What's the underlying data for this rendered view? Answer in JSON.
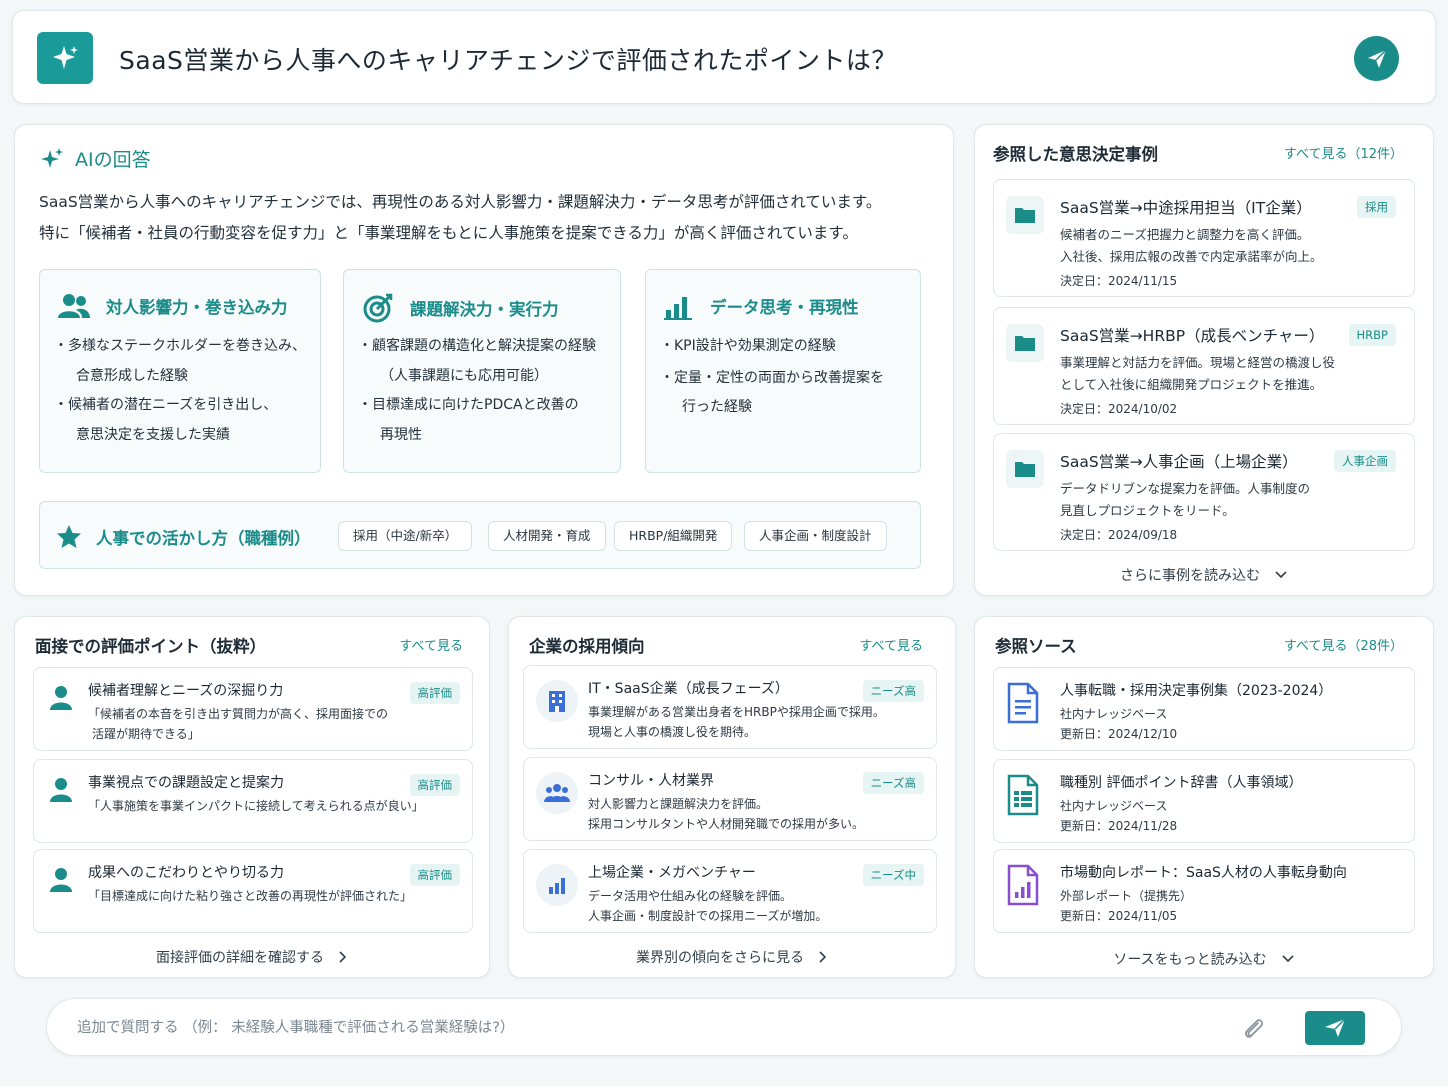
{
  "query": {
    "text": "SaaS営業から人事へのキャリアチェンジで評価されたポイントは？"
  },
  "ai_answer": {
    "title": "AIの回答",
    "summary_line1": "SaaS営業から人事へのキャリアチェンジでは、再現性のある対人影響力・課題解決力・データ思考が評価されています。",
    "summary_line2": "特に「候補者・社員の行動変容を促す力」と「事業理解をもとに人事施策を提案できる力」が高く評価されています。",
    "skills": [
      {
        "title": "対人影響力・巻き込み力",
        "icon": "people-icon",
        "points": [
          {
            "line1": "・多様なステークホルダーを巻き込み、",
            "line2": "合意形成した経験"
          },
          {
            "line1": "・候補者の潜在ニーズを引き出し、",
            "line2": "意思決定を支援した実績"
          }
        ]
      },
      {
        "title": "課題解決力・実行力",
        "icon": "target-icon",
        "points": [
          {
            "line1": "・顧客課題の構造化と解決提案の経験",
            "line2": "（人事課題にも応用可能）"
          },
          {
            "line1": "・目標達成に向けたPDCAと改善の",
            "line2": "再現性"
          }
        ]
      },
      {
        "title": "データ思考・再現性",
        "icon": "bar-chart-icon",
        "points": [
          {
            "line1": "・KPI設計や効果測定の経験",
            "line2": ""
          },
          {
            "line1": "・定量・定性の両面から改善提案を",
            "line2": "行った経験"
          }
        ]
      }
    ],
    "roles": {
      "title": "人事での活かし方（職種例）",
      "chips": [
        "採用（中途/新卒）",
        "人材開発・育成",
        "HRBP/組織開発",
        "人事企画・制度設計"
      ]
    }
  },
  "cases": {
    "title": "参照した意思決定事例",
    "link": "すべて見る（12件）",
    "items": [
      {
        "title": "SaaS営業→中途採用担当（IT企業）",
        "tag": "採用",
        "desc1": "候補者のニーズ把握力と調整力を高く評価。",
        "desc2": "入社後、採用広報の改善で内定承諾率が向上。",
        "date": "決定日：2024/11/15"
      },
      {
        "title": "SaaS営業→HRBP（成長ベンチャー）",
        "tag": "HRBP",
        "desc1": "事業理解と対話力を評価。現場と経営の橋渡し役",
        "desc2": "として入社後に組織開発プロジェクトを推進。",
        "date": "決定日：2024/10/02"
      },
      {
        "title": "SaaS営業→人事企画（上場企業）",
        "tag": "人事企画",
        "desc1": "データドリブンな提案力を評価。人事制度の",
        "desc2": "見直しプロジェクトをリード。",
        "date": "決定日：2024/09/18"
      }
    ],
    "more": "さらに事例を読み込む"
  },
  "evaluation": {
    "title": "面接での評価ポイント（抜粋）",
    "link": "すべて見る",
    "items": [
      {
        "title": "候補者理解とニーズの深掘り力",
        "tag": "高評価",
        "desc1": "「候補者の本音を引き出す質問力が高く、採用面接での",
        "desc2": "活躍が期待できる」"
      },
      {
        "title": "事業視点での課題設定と提案力",
        "tag": "高評価",
        "desc1": "「人事施策を事業インパクトに接続して考えられる点が良い」",
        "desc2": ""
      },
      {
        "title": "成果へのこだわりとやり切る力",
        "tag": "高評価",
        "desc1": "「目標達成に向けた粘り強さと改善の再現性が評価された」",
        "desc2": ""
      }
    ],
    "more": "面接評価の詳細を確認する"
  },
  "trends": {
    "title": "企業の採用傾向",
    "link": "すべて見る",
    "items": [
      {
        "title": "IT・SaaS企業（成長フェーズ）",
        "tag": "ニーズ高",
        "icon": "building-icon",
        "desc1": "事業理解がある営業出身者をHRBPや採用企画で採用。",
        "desc2": "現場と人事の橋渡し役を期待。"
      },
      {
        "title": "コンサル・人材業界",
        "tag": "ニーズ高",
        "icon": "group-icon",
        "desc1": "対人影響力と課題解決力を評価。",
        "desc2": "採用コンサルタントや人材開発職での採用が多い。"
      },
      {
        "title": "上場企業・メガベンチャー",
        "tag": "ニーズ中",
        "icon": "chart-icon",
        "desc1": "データ活用や仕組み化の経験を評価。",
        "desc2": "人事企画・制度設計での採用ニーズが増加。"
      }
    ],
    "more": "業界別の傾向をさらに見る"
  },
  "sources": {
    "title": "参照ソース",
    "link": "すべて見る（28件）",
    "items": [
      {
        "title": "人事転職・採用決定事例集（2023-2024）",
        "sub": "社内ナレッジベース",
        "date": "更新日：2024/12/10",
        "icon": "document-icon"
      },
      {
        "title": "職種別 評価ポイント辞書（人事領域）",
        "sub": "社内ナレッジベース",
        "date": "更新日：2024/11/28",
        "icon": "spreadsheet-icon"
      },
      {
        "title": "市場動向レポート：SaaS人材の人事転身動向",
        "sub": "外部レポート（提携先）",
        "date": "更新日：2024/11/05",
        "icon": "report-icon"
      }
    ],
    "more": "ソースをもっと読み込む"
  },
  "followup": {
    "placeholder": "追加で質問する （例： 未経験人事職種で評価される営業経験は?）"
  },
  "colors": {
    "accent": "#1a8c8a",
    "tag_bg": "#e6f4f3",
    "building_blue": "#3a6fd8",
    "report_purple": "#8a4fd0"
  }
}
